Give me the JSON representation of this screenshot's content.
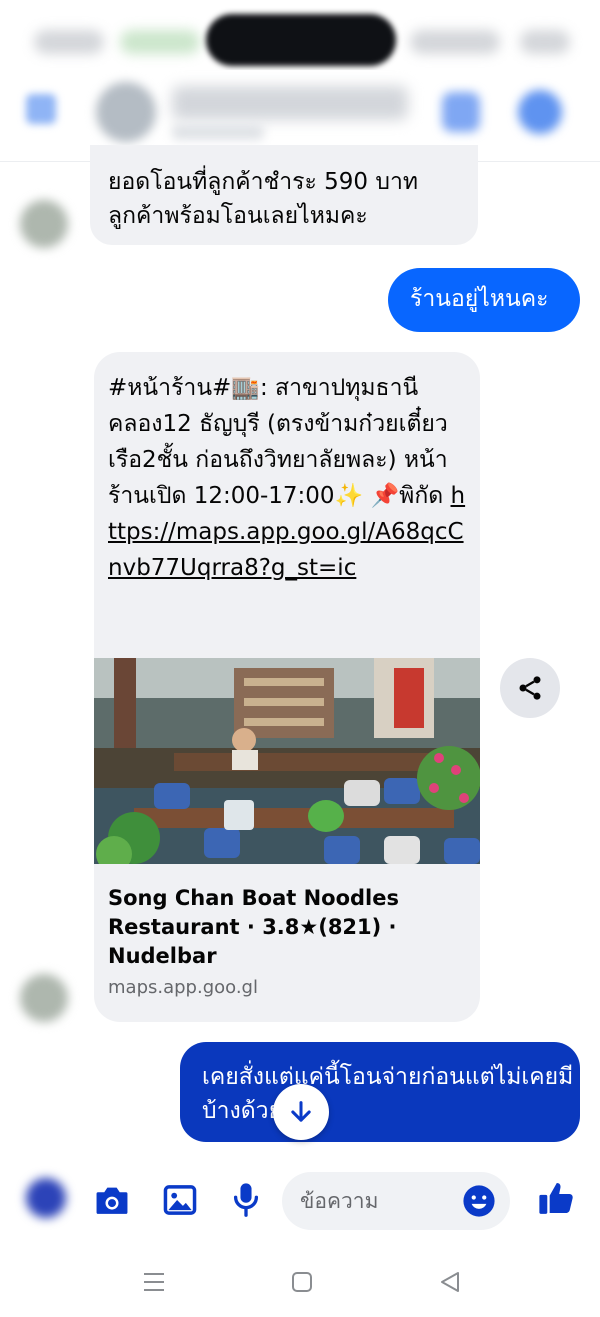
{
  "messages": {
    "incoming_1": {
      "line1": "ยอดโอนที่ลูกค้าชำระ 590 บาท",
      "line2": "ลูกค้าพร้อมโอนเลยไหมคะ"
    },
    "outgoing_1": "ร้านอยู่ไหนคะ",
    "card": {
      "text_prefix": "#หน้าร้าน#",
      "storefront_emoji": "🏬",
      "text_body": ": สาขาปทุมธานี คลอง12 ธัญบุรี  (ตรงข้ามก๋วยเตี๋ยวเรือ2ชั้น ก่อนถึงวิทยาลัยพละ) หน้าร้านเปิด 12:00-17:00",
      "sparkle_emoji": "✨",
      "pin_emoji": "📌",
      "text_suffix": "พิกัด",
      "link": "https://maps.app.goo.gl/A68qcCnvb77Uqrra8?g_st=ic",
      "preview_title": "Song Chan Boat Noodles Restaurant · 3.8★(821) · Nudelbar",
      "preview_domain": "maps.app.goo.gl"
    },
    "outgoing_2": "เคยสั่งแต่แค่นี้โอนจ่ายก่อนแต่ไม่เคยมีบ้างด้วย"
  },
  "composer": {
    "placeholder": "ข้อความ"
  },
  "icons": {
    "share": "share-icon",
    "scroll_down": "arrow-down-icon",
    "camera": "camera-icon",
    "gallery": "image-icon",
    "mic": "microphone-icon",
    "emoji": "emoji-icon",
    "like": "thumbs-up-icon",
    "nav_recent": "recent-apps-icon",
    "nav_home": "home-icon",
    "nav_back": "back-icon"
  },
  "colors": {
    "outgoing_bubble": "#0866ff",
    "outgoing_bubble_selected": "#0a38bd",
    "incoming_bubble": "#f0f1f4",
    "accent": "#0a3ac8"
  }
}
